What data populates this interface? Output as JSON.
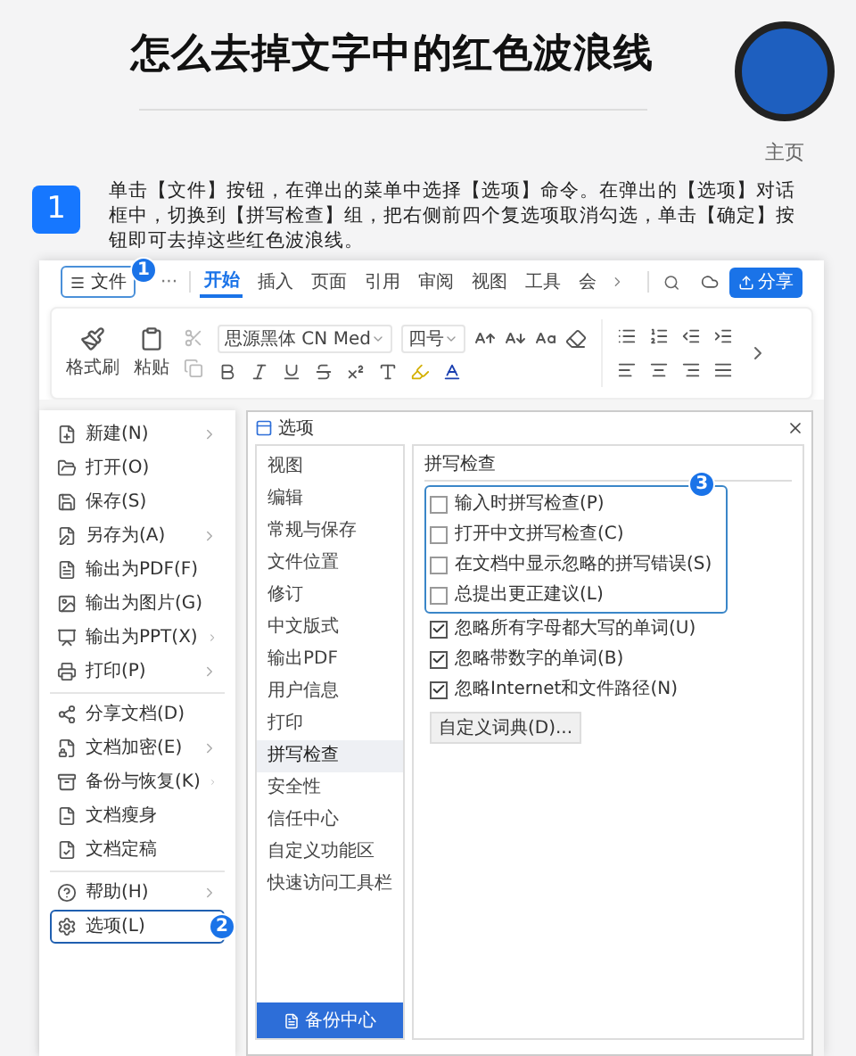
{
  "title": "怎么去掉文字中的红色波浪线",
  "profile": {
    "label": "主页"
  },
  "step": {
    "number": "1",
    "text": "单击【文件】按钮，在弹出的菜单中选择【选项】命令。在弹出的【选项】对话框中，切换到【拼写检查】组，把右侧前四个复选项取消勾选，单击【确定】按钮即可去掉这些红色波浪线。"
  },
  "screenshot": {
    "toolbar": {
      "file_button": {
        "label": "文件",
        "callout": "1"
      },
      "more": "···",
      "tabs": [
        {
          "label": "开始",
          "selected": true
        },
        {
          "label": "插入",
          "selected": false
        },
        {
          "label": "页面",
          "selected": false
        },
        {
          "label": "引用",
          "selected": false
        },
        {
          "label": "审阅",
          "selected": false
        },
        {
          "label": "视图",
          "selected": false
        },
        {
          "label": "工具",
          "selected": false
        },
        {
          "label": "会",
          "selected": false
        }
      ],
      "share_button": "分享"
    },
    "ribbon": {
      "format_painter": "格式刷",
      "paste": "粘贴",
      "font_name": "思源黑体 CN Med",
      "font_size": "四号"
    },
    "file_menu": [
      [
        {
          "label": "新建(N)",
          "submenu": true,
          "selected": false
        },
        {
          "label": "打开(O)",
          "submenu": false,
          "selected": false
        },
        {
          "label": "保存(S)",
          "submenu": false,
          "selected": false
        },
        {
          "label": "另存为(A)",
          "submenu": true,
          "selected": false
        },
        {
          "label": "输出为PDF(F)",
          "submenu": false,
          "selected": false
        },
        {
          "label": "输出为图片(G)",
          "submenu": false,
          "selected": false
        },
        {
          "label": "输出为PPT(X)",
          "submenu": true,
          "selected": false
        },
        {
          "label": "打印(P)",
          "submenu": true,
          "selected": false
        }
      ],
      [
        {
          "label": "分享文档(D)",
          "submenu": false,
          "selected": false
        },
        {
          "label": "文档加密(E)",
          "submenu": true,
          "selected": false
        },
        {
          "label": "备份与恢复(K)",
          "submenu": true,
          "selected": false
        },
        {
          "label": "文档瘦身",
          "submenu": false,
          "selected": false
        },
        {
          "label": "文档定稿",
          "submenu": false,
          "selected": false
        }
      ],
      [
        {
          "label": "帮助(H)",
          "submenu": true,
          "selected": false
        },
        {
          "label": "选项(L)",
          "submenu": false,
          "selected": true,
          "callout": "2"
        }
      ]
    ],
    "options_dialog": {
      "title": "选项",
      "nav": [
        {
          "label": "视图",
          "selected": false
        },
        {
          "label": "编辑",
          "selected": false
        },
        {
          "label": "常规与保存",
          "selected": false
        },
        {
          "label": "文件位置",
          "selected": false
        },
        {
          "label": "修订",
          "selected": false
        },
        {
          "label": "中文版式",
          "selected": false
        },
        {
          "label": "输出PDF",
          "selected": false
        },
        {
          "label": "用户信息",
          "selected": false
        },
        {
          "label": "打印",
          "selected": false
        },
        {
          "label": "拼写检查",
          "selected": true
        },
        {
          "label": "安全性",
          "selected": false
        },
        {
          "label": "信任中心",
          "selected": false
        },
        {
          "label": "自定义功能区",
          "selected": false
        },
        {
          "label": "快速访问工具栏",
          "selected": false
        }
      ],
      "backup_button": "备份中心",
      "section_title": "拼写检查",
      "callout": "3",
      "highlighted_checks": [
        {
          "label": "输入时拼写检查(P)",
          "checked": false
        },
        {
          "label": "打开中文拼写检查(C)",
          "checked": false
        },
        {
          "label": "在文档中显示忽略的拼写错误(S)",
          "checked": false
        },
        {
          "label": "总提出更正建议(L)",
          "checked": false
        }
      ],
      "other_checks": [
        {
          "label": "忽略所有字母都大写的单词(U)",
          "checked": true
        },
        {
          "label": "忽略带数字的单词(B)",
          "checked": true
        },
        {
          "label": "忽略Internet和文件路径(N)",
          "checked": true
        }
      ],
      "dictionary_button": "自定义词典(D)..."
    }
  }
}
